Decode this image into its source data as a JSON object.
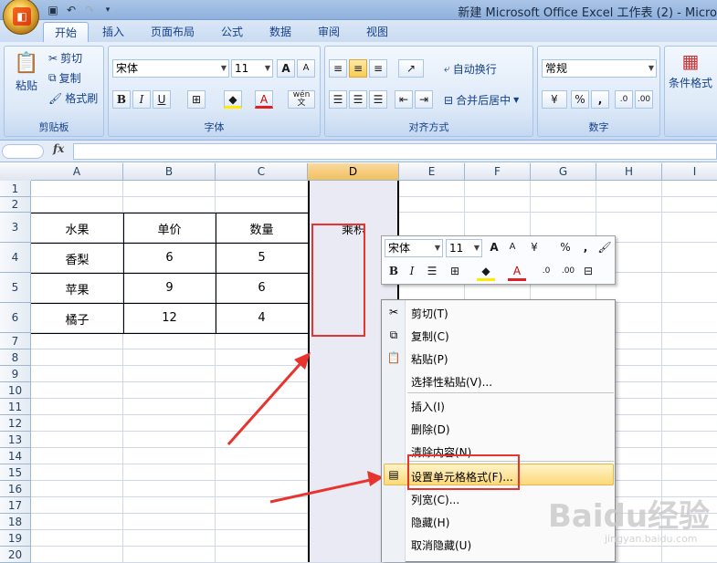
{
  "window": {
    "title": "新建 Microsoft Office Excel 工作表 (2) - Micro"
  },
  "tabs": [
    "开始",
    "插入",
    "页面布局",
    "公式",
    "数据",
    "审阅",
    "视图"
  ],
  "ribbon": {
    "clipboard": {
      "paste": "粘贴",
      "cut": "剪切",
      "copy": "复制",
      "format_painter": "格式刷",
      "label": "剪贴板"
    },
    "font": {
      "name": "宋体",
      "size": "11",
      "label": "字体",
      "bold": "B",
      "italic": "I",
      "underline": "U",
      "grow": "A",
      "shrink": "A",
      "wen": "wén",
      "wen2": "文",
      "font_color": "A"
    },
    "alignment": {
      "wrap": "自动换行",
      "merge": "合并后居中",
      "label": "对齐方式"
    },
    "number": {
      "format": "常规",
      "percent": "%",
      "comma": ",",
      "inc": ".0",
      "dec": ".00",
      "label": "数字"
    },
    "styles": {
      "conditional": "条件格式"
    }
  },
  "formula_bar": {
    "fx": "fx",
    "value": ""
  },
  "columns": [
    "A",
    "B",
    "C",
    "D",
    "E",
    "F",
    "G",
    "H",
    "I"
  ],
  "rows": [
    "1",
    "2",
    "3",
    "4",
    "5",
    "6",
    "7",
    "8",
    "9",
    "10",
    "11",
    "12",
    "13",
    "14",
    "15",
    "16",
    "17",
    "18",
    "19",
    "20"
  ],
  "table": {
    "headers": [
      "水果",
      "单价",
      "数量",
      "乘积"
    ],
    "rows": [
      [
        "香梨",
        "6",
        "5"
      ],
      [
        "苹果",
        "9",
        "6"
      ],
      [
        "橘子",
        "12",
        "4"
      ]
    ]
  },
  "minibar": {
    "font": "宋体",
    "size": "11",
    "percent": "%",
    "comma": ",",
    "bold": "B",
    "italic": "I",
    "inc": ".0",
    "dec": ".00",
    "font_color": "A"
  },
  "context_menu": {
    "items": [
      "剪切(T)",
      "复制(C)",
      "粘贴(P)",
      "选择性粘贴(V)...",
      "插入(I)",
      "删除(D)",
      "清除内容(N)",
      "设置单元格格式(F)...",
      "列宽(C)...",
      "隐藏(H)",
      "取消隐藏(U)"
    ]
  },
  "watermark": {
    "brand": "Baidu经验",
    "url": "jingyan.baidu.com"
  },
  "colors": {
    "highlight": "#fcd97a",
    "annotation": "#e8342f",
    "selected_column": "#e9eaf3"
  }
}
